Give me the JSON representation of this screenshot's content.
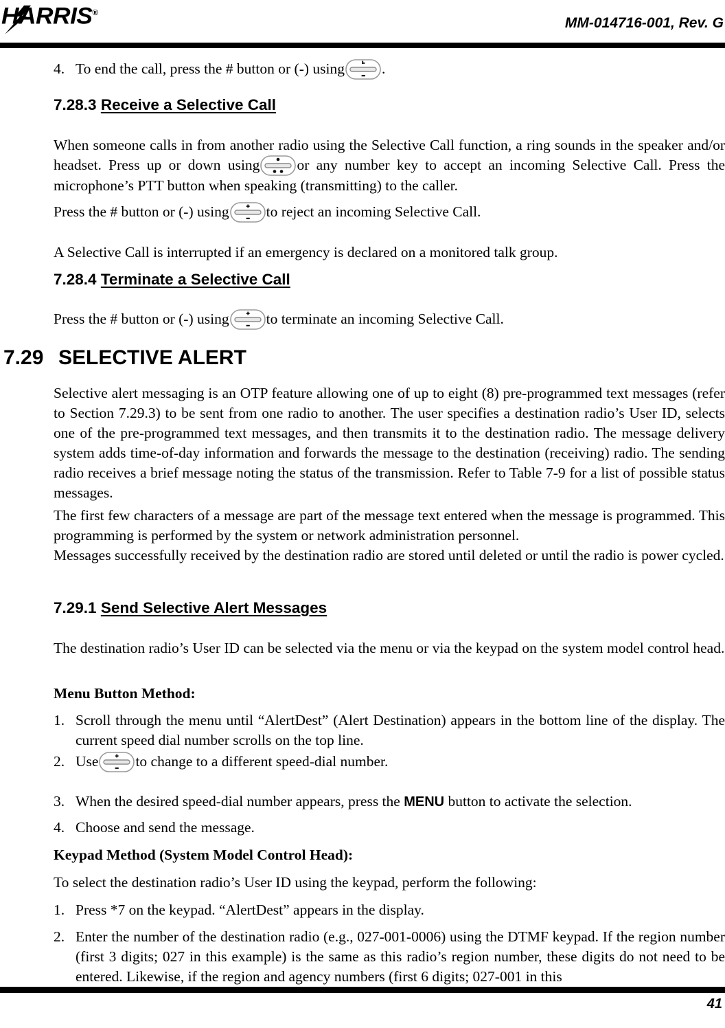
{
  "header": {
    "logo_text": "HARRIS",
    "logo_registered": "®",
    "document_id": "MM-014716-001, Rev. G"
  },
  "footer": {
    "page_number": "41"
  },
  "icons": {
    "rocker_plus": "+",
    "rocker_minus": "-"
  },
  "content": {
    "item4_top": {
      "number": "4.",
      "text_before": "To end the call, press the # button or (-) using",
      "text_after": "."
    },
    "heading_7283": {
      "number": "7.28.3",
      "title": "Receive a Selective Call"
    },
    "para_receive": {
      "part1": "When someone calls in from another radio using the Selective Call function, a ring sounds in the speaker and/or headset. Press up or down using",
      "part2": "or any number key to accept an incoming Selective Call. Press the microphone’s PTT button when speaking (transmitting) to the caller."
    },
    "para_reject": {
      "part1": "Press the # button or (-) using",
      "part2": "to reject an incoming Selective Call."
    },
    "para_interrupt": {
      "text": "A Selective Call is interrupted if an emergency is declared on a monitored talk group."
    },
    "heading_7284": {
      "number": "7.28.4",
      "title": "Terminate a Selective Call"
    },
    "para_terminate": {
      "part1": "Press the # button or (-) using",
      "part2": "to terminate an incoming Selective Call."
    },
    "heading_729": {
      "number": "7.29",
      "title": "SELECTIVE ALERT"
    },
    "para_alert_1": {
      "text": "Selective alert messaging is an OTP feature allowing one of up to eight (8) pre-programmed text messages (refer to Section 7.29.3) to be sent from one radio to another. The user specifies a destination radio’s User ID, selects one of the pre-programmed text messages, and then transmits it to the destination radio. The message delivery system adds time-of-day information and forwards the message to the destination (receiving) radio. The sending radio receives a brief message noting the status of the transmission. Refer to Table 7-9 for a list of possible status messages."
    },
    "para_alert_2": {
      "text": "The first few characters of a message are part of the message text entered when the message is programmed. This programming is performed by the system or network administration personnel."
    },
    "para_alert_3": {
      "text": "Messages successfully received by the destination radio are stored until deleted or until the radio is power cycled."
    },
    "heading_7291": {
      "number": "7.29.1",
      "title": "Send Selective Alert Messages"
    },
    "para_send_intro": {
      "text": "The destination radio’s User ID can be selected via the menu or via the keypad on the system model control head."
    },
    "menu_method_label": "Menu Button Method:",
    "menu_steps": [
      {
        "number": "1.",
        "text": "Scroll through the menu until “AlertDest” (Alert Destination) appears in the bottom line of the display. The current speed dial number scrolls on the top line."
      },
      {
        "number": "2.",
        "text_before": "Use",
        "text_after": "to change to a different speed-dial number."
      },
      {
        "number": "3.",
        "text_before": "When the desired speed-dial number appears, press the",
        "keyword": "MENU",
        "text_after": "button to activate the selection."
      },
      {
        "number": "4.",
        "text": "Choose and send the message."
      }
    ],
    "keypad_method_label": "Keypad Method (System Model Control Head):",
    "para_keypad_intro": {
      "text": "To select the destination radio’s User ID using the keypad, perform the following:"
    },
    "keypad_steps": [
      {
        "number": "1.",
        "text": "Press *7 on the keypad. “AlertDest” appears in the display."
      },
      {
        "number": "2.",
        "text": "Enter the number of the destination radio (e.g., 027-001-0006) using the DTMF keypad. If the region number (first 3 digits; 027 in this example) is the same as this radio’s region number, these digits do not need to be entered. Likewise, if the region and agency numbers (first 6 digits; 027-001 in this"
      }
    ]
  }
}
